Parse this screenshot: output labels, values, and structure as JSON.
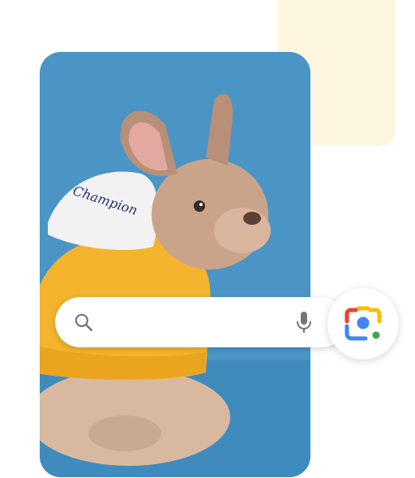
{
  "search": {
    "value": "",
    "placeholder": ""
  },
  "photo": {
    "hoodie_text": "Champion"
  },
  "icons": {
    "search": "search-icon",
    "mic": "mic-icon",
    "lens": "google-lens-icon"
  },
  "colors": {
    "background": "#ffffff",
    "photo_backdrop": "#4a95c6",
    "accent_card": "#fef7e0",
    "hoodie": "#f4b42e",
    "lens_blue": "#4285f4",
    "lens_red": "#ea4335",
    "lens_yellow": "#fbbc04",
    "lens_green": "#34a853",
    "icon_gray": "#70757a"
  }
}
